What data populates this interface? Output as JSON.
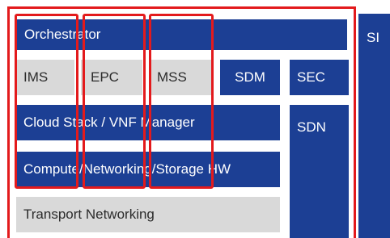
{
  "diagram": {
    "orchestrator": "Orchestrator",
    "si": "SI",
    "ims": "IMS",
    "epc": "EPC",
    "mss": "MSS",
    "sdm": "SDM",
    "sec": "SEC",
    "sdn": "SDN",
    "cloud_stack": "Cloud Stack / VNF Manager",
    "compute": "Compute/Networking/Storage HW",
    "transport": "Transport Networking"
  },
  "colors": {
    "block_blue": "#1c3f94",
    "block_gray": "#d9d9d9",
    "highlight_red": "#e31a1c"
  }
}
